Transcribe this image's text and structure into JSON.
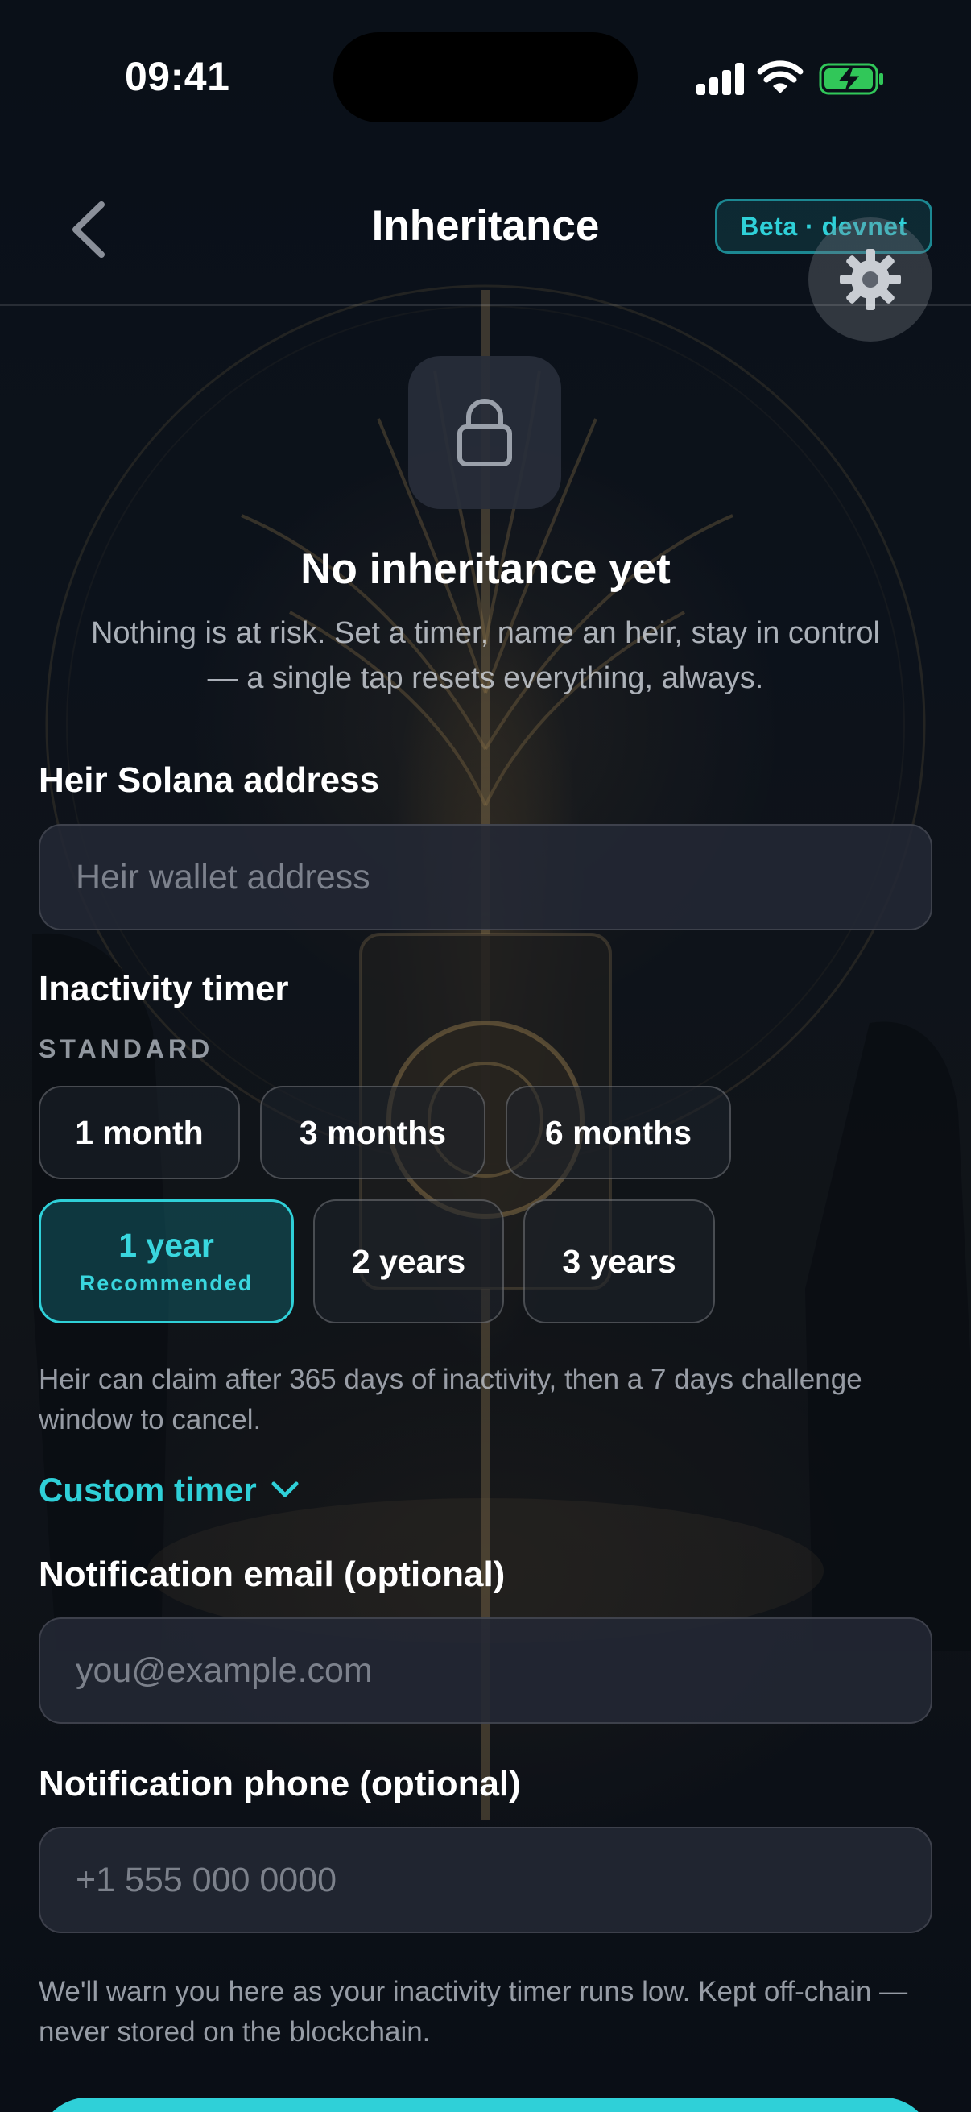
{
  "status_bar": {
    "time": "09:41"
  },
  "nav": {
    "title": "Inheritance",
    "badge": "Beta · devnet"
  },
  "hero": {
    "title": "No inheritance yet",
    "subtitle": "Nothing is at risk. Set a timer, name an heir, stay in control — a single tap resets everything, always."
  },
  "heir": {
    "label": "Heir Solana address",
    "placeholder": "Heir wallet address",
    "value": ""
  },
  "timer": {
    "label": "Inactivity timer",
    "group_label": "STANDARD",
    "options": [
      {
        "label": "1 month"
      },
      {
        "label": "3 months"
      },
      {
        "label": "6 months"
      },
      {
        "label": "1 year",
        "sublabel": "Recommended",
        "selected": true
      },
      {
        "label": "2 years"
      },
      {
        "label": "3 years"
      }
    ],
    "helper": "Heir can claim after 365 days of inactivity, then a 7 days challenge window to cancel.",
    "custom_label": "Custom timer"
  },
  "email": {
    "label": "Notification email (optional)",
    "placeholder": "you@example.com",
    "value": ""
  },
  "phone": {
    "label": "Notification phone (optional)",
    "placeholder": "+1 555 000 0000",
    "value": ""
  },
  "notice": "We'll warn you here as your inactivity timer runs low. Kept off-chain — never stored on the blockchain.",
  "colors": {
    "accent": "#2fd0d8",
    "background": "#0b1119",
    "field": "#23283a"
  },
  "icons": {
    "back": "chevron-left-icon",
    "settings": "gear-icon",
    "lock": "lock-icon",
    "custom_timer": "chevron-down-icon"
  }
}
